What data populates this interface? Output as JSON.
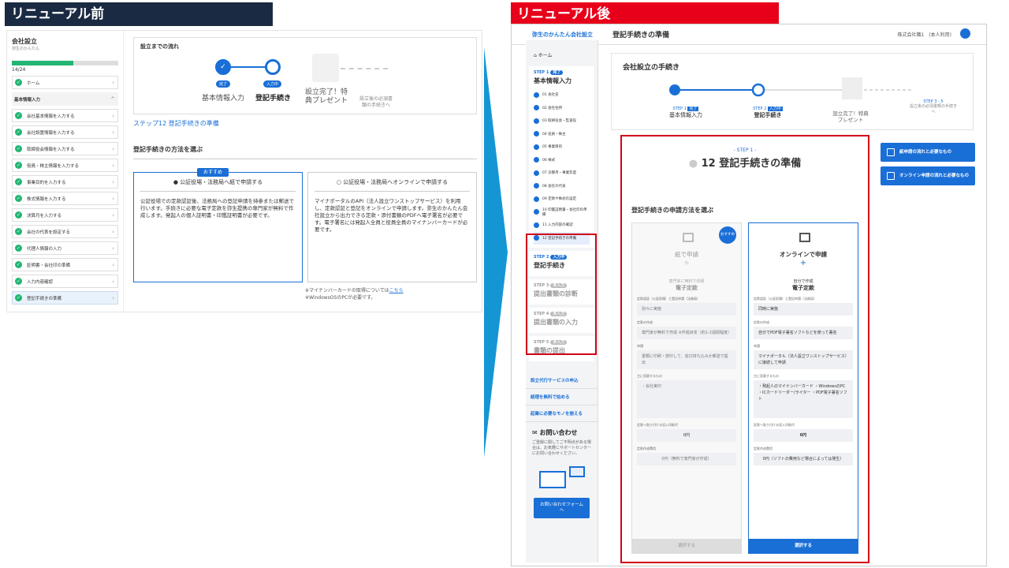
{
  "headers": {
    "before": "リニューアル前",
    "after": "リニューアル後"
  },
  "before": {
    "company": "会社設立",
    "company_sub": "弥生のかんたん",
    "progress_count": "14/24",
    "progress_fraction": 0.58,
    "sidebar": [
      "ホーム",
      "基本情報入力",
      "会社基本情報を入力する",
      "会社設置情報を入力する",
      "取締役会情報を入力する",
      "役員・株主情報を入力する",
      "事業目的を入力する",
      "株式情報を入力する",
      "決算月を入力する",
      "会社の代表を設定する",
      "代理人情報の入力",
      "証明書・会社印の準備",
      "入力内容確認",
      "登記手続きの準備"
    ],
    "flow_title": "設立までの流れ",
    "steps": [
      {
        "badge": "完了",
        "label": "基本情報入力"
      },
      {
        "badge": "入力中",
        "label": "登記手続き"
      },
      {
        "badge": "",
        "label": "設立完了！特典プレゼント"
      }
    ],
    "after_note": "設立後の必須書類の手続きへ",
    "step_link": "ステップ12 登記手続きの準備",
    "choose_heading": "登記手続きの方法を選ぶ",
    "recommend": "おすすめ",
    "opt_paper": "公証役場・法務局へ紙で申請する",
    "opt_paper_text": "公証役場での定款認証後、法務局への登記申請を持参または郵送で行います。手続きに必要な電子定款を弥生提携の専門家が無料で作成します。発起人の個人証明書・印鑑証明書が必要です。",
    "opt_online": "公証役場・法務局へオンラインで申請する",
    "opt_online_text": "マイナポータルのAPI（法人設立ワンストップサービス）を利用し、定款認証と登記をオンラインで申請します。弥生のかんたん会社設立から出力できる定款・添付書類のPDFへ電子署名が必要です。電子署名には発起人全員と役員全員のマイナンバーカードが必要です。",
    "foot1": "※マイナンバーカードの取得については",
    "foot1_link": "こちら",
    "foot2": "※WindowsOSのPCが必要です。"
  },
  "after": {
    "logo": "弥生のかんたん会社設立",
    "page_title": "登記手続きの準備",
    "user": "株式会社職1　(本人利用)",
    "home": "ホーム",
    "step1": {
      "label": "STEP 1",
      "badge": "完了",
      "name": "基本情報入力"
    },
    "items": [
      "01 会社名",
      "02 会社住所",
      "03 取締役会・監査役",
      "04 役員・株主",
      "05 事業目的",
      "06 株式",
      "07 決算月・事業年度",
      "08 会社の代表",
      "09 定款や株式の設定",
      "10 印鑑証明書・会社印の準備",
      "11 入力内容の確認",
      "12 登記手続きの準備"
    ],
    "step2": {
      "label": "STEP 2",
      "badge": "入力中",
      "name": "登記手続き"
    },
    "step3": {
      "label": "STEP 3",
      "badge": "未入力",
      "name": "提出書類の診断"
    },
    "step4": {
      "label": "STEP 4",
      "badge": "未入力",
      "name": "提出書類の入力"
    },
    "step5": {
      "label": "STEP 5",
      "badge": "未入力",
      "name": "書類の提出"
    },
    "links": [
      "設立代行サービスの申込",
      "経理を無料で始める",
      "起業に必要なモノを揃える"
    ],
    "contact_title": "お問い合わせ",
    "contact_text": "ご登録に関してご不明点がある場合は、お気軽にサポートセンターにお問い合わせください。",
    "contact_btn": "お問い合わせフォームへ",
    "flow_title": "会社設立の手続き",
    "steps": [
      {
        "label": "STEP 1",
        "badge": "完了",
        "name": "基本情報入力"
      },
      {
        "label": "STEP 2",
        "badge": "入力中",
        "name": "登記手続き"
      },
      {
        "label": "",
        "badge": "",
        "name": "設立完了！特典プレゼント"
      },
      {
        "label": "STEP 3 - 5",
        "badge": "",
        "name": "設立後の必須書類の手続きへ"
      }
    ],
    "step_cap": "- STEP 1 -",
    "step_title": "12 登記手続きの準備",
    "choose_heading": "登記手続きの申請方法を選ぶ",
    "paper": {
      "title": "紙で申請",
      "recommend": "おすすめ",
      "sub": "専門家に無料で依頼",
      "sub2": "電子定款",
      "f1l": "定款認証（公証役場）と登記申請（法務局）",
      "f1v": "別々に実施",
      "f2l": "定款の作成",
      "f2v": "専門家が無料で作成 ※作成目安（約1-2週間程度）",
      "f3l": "申請",
      "f3v": "書類に印刷・捺印して、窓口持ち込みか郵送で提出",
      "f4l": "主に用意するもの",
      "f4v": "・会社実印",
      "f5l": "定款へ貼り付ける収入印紙代",
      "f5v": "0円",
      "f6l": "定款作成費用",
      "f6v": "0円（無料で専門家が作成）",
      "btn": "選択する"
    },
    "online": {
      "title": "オンラインで申請",
      "sub": "自分で作成",
      "sub2": "電子定款",
      "f1l": "定款認証（公証役場）と登記申請（法務局）",
      "f1v": "同時に実施",
      "f2l": "定款の作成",
      "f2v": "自分でPDF電子署名ソフトなどを使って署名",
      "f3l": "申請",
      "f3v": "マイナポータル（法人設立ワンストップサービス）に接続して申請",
      "f4l": "主に用意するもの",
      "f4v": "・発起人のマイナンバーカード ・WindowsのPC ・ICカードリーダー/ライター ・PDF電子署名ソフト",
      "f5l": "定款へ貼り付ける収入印紙代",
      "f5v": "0円",
      "f6l": "定款作成費用",
      "f6v": "0円（ソフトの費用など場合によっては発生）",
      "btn": "選択する"
    },
    "right_btns": [
      "紙申請の流れと必要なもの",
      "オンライン申請の流れと必要なもの"
    ]
  }
}
